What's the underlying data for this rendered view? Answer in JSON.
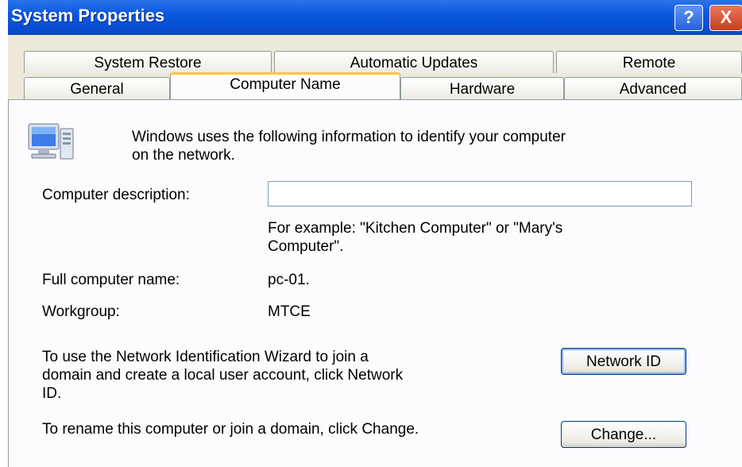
{
  "window": {
    "title": "System Properties",
    "help_label": "?",
    "close_label": "X"
  },
  "tabs": {
    "row1": [
      "System Restore",
      "Automatic Updates",
      "Remote"
    ],
    "row2": [
      "General",
      "Computer Name",
      "Hardware",
      "Advanced"
    ],
    "active": "Computer Name"
  },
  "content": {
    "intro": "Windows uses the following information to identify your computer",
    "intro_line2": "on the network.",
    "description_label": "Computer description:",
    "description_value": "",
    "example_line1": "For example: \"Kitchen Computer\" or \"Mary's",
    "example_line2": "Computer\".",
    "full_name_label": "Full computer name:",
    "full_name_value": "pc-01.",
    "workgroup_label": "Workgroup:",
    "workgroup_value": "MTCE",
    "wizard_line1": "To use the Network Identification Wizard to join a",
    "wizard_line2": "domain and create a local user account, click Network",
    "wizard_line3": "ID.",
    "network_id_button": "Network ID",
    "rename_text": "To rename this computer or join a domain, click Change.",
    "change_button": "Change..."
  },
  "icons": {
    "computer": "computer-icon"
  }
}
